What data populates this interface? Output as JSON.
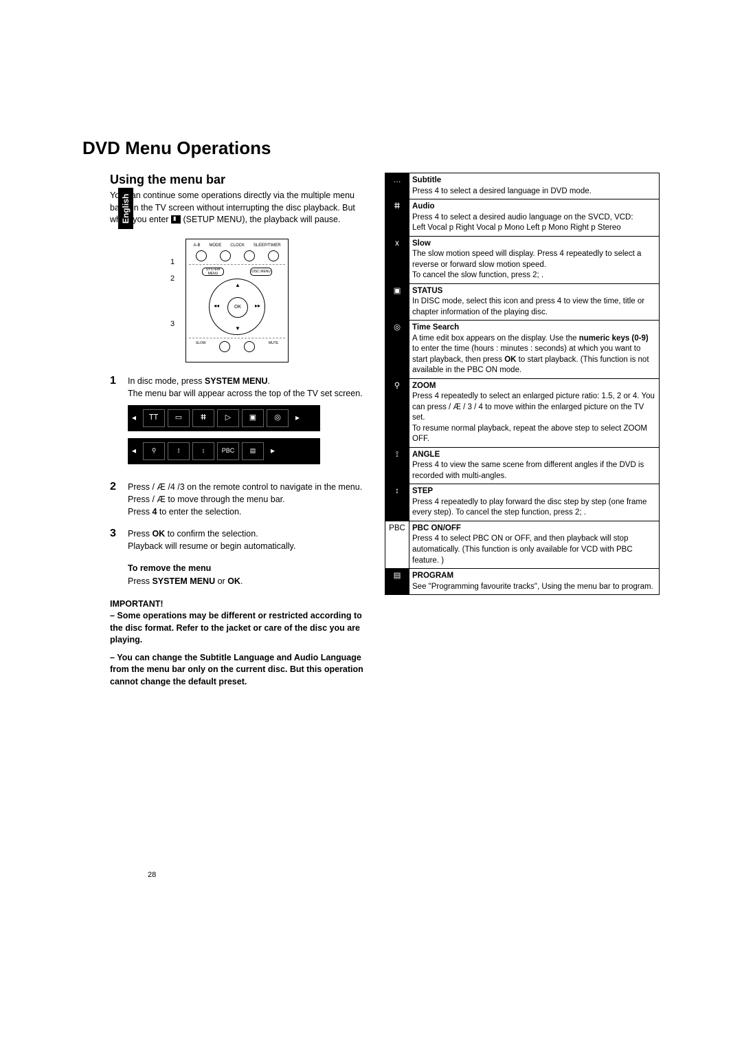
{
  "lang_tab": "English",
  "title": "DVD Menu Operations",
  "subheading": "Using the menu bar",
  "intro_1": "You can continue some operations directly via the multiple menu bars on the TV screen without interrupting the disc playback. But when you enter ",
  "intro_2": " (SETUP MENU), the playback will pause.",
  "diagram": {
    "toprow": [
      "A-B",
      "MODE",
      "CLOCK",
      "SLEEP/TIMER"
    ],
    "system_menu": "SYSTEM MENU",
    "disc_menu": "DISC MENU",
    "ok": "OK",
    "slow": "SLOW",
    "mute": "MUTE",
    "callouts": [
      "1",
      "2",
      "3"
    ]
  },
  "step1": {
    "num": "1",
    "l1a": "In disc mode, press ",
    "l1b": "SYSTEM MENU",
    "l1c": ".",
    "l2": "The menu bar will appear across the top of the TV set screen."
  },
  "bar1_cells": [
    "ᎢᎢ",
    "▭",
    "ⵌ",
    "▷",
    "▣",
    "◎"
  ],
  "bar2_cells": [
    "⚲",
    "⟟",
    "↕",
    "PBC",
    "▤"
  ],
  "step2": {
    "num": "2",
    "l1a": "Press ",
    "l1b": " / Æ /4 /3",
    "l1c": " on the remote control to navigate in the menu.",
    "l2a": "Press ",
    "l2b": " / Æ",
    "l2c": " to move through the menu bar.",
    "l3a": "Press ",
    "l3b": "4",
    "l3c": " to enter the selection."
  },
  "step3": {
    "num": "3",
    "l1a": "Press ",
    "l1b": "OK",
    "l1c": " to confirm the selection.",
    "l2": "Playback will resume or begin automatically."
  },
  "remove": {
    "h": "To remove the menu",
    "a": "Press ",
    "b": "SYSTEM MENU",
    "c": " or ",
    "d": "OK",
    "e": "."
  },
  "important_h": "IMPORTANT!",
  "important_1": "– Some operations may be different or restricted according to the disc format. Refer to the jacket or care of the disc you are playing.",
  "important_2": "– You can change the Subtitle Language and Audio Language from the menu bar only on the current disc. But this operation cannot change the default preset.",
  "table": [
    {
      "icon": "…",
      "dark": true,
      "title": "Subtitle",
      "body": "Press 4  to select a desired language in DVD mode."
    },
    {
      "icon": "ⵌ",
      "dark": true,
      "title": "Audio",
      "body": "Press 4  to select a desired audio language on the SVCD, VCD:\nLeft Vocal p   Right Vocal p   Mono Left p   Mono Right p   Stereo"
    },
    {
      "icon": "x",
      "dark": true,
      "title": "Slow",
      "body": "The slow motion speed will display. Press 4 repeatedly to select a reverse or forward slow motion speed.\nTo cancel the slow function, press 2;  ."
    },
    {
      "icon": "▣",
      "dark": true,
      "title": "STATUS",
      "body": "In DISC mode, select this icon and press 4  to view the time, title or chapter information of the playing disc."
    },
    {
      "icon": "◎",
      "dark": true,
      "title": "Time Search",
      "body": "A time edit box appears on the display. Use the <b>numeric keys (0-9)</b> to enter the time (hours : minutes : seconds) at which you want to start playback, then press <b>OK</b> to start playback. (This function is not available in the PBC ON mode."
    },
    {
      "icon": "⚲",
      "dark": true,
      "title": "ZOOM",
      "body": "Press 4  repeatedly to select an enlarged picture ratio: 1.5, 2 or 4. You can press       / Æ / 3  / 4  to move within the enlarged picture on the TV set.\nTo resume normal playback, repeat the above step to select ZOOM OFF."
    },
    {
      "icon": "⟟",
      "dark": true,
      "title": "ANGLE",
      "body": "Press 4  to view the same scene from different angles  if the DVD is recorded with multi-angles."
    },
    {
      "icon": "↕",
      "dark": true,
      "title": "STEP",
      "body": "Press 4  repeatedly to play forward the disc step by step (one frame every step). To cancel the step function, press 2;  ."
    },
    {
      "icon": "PBC",
      "dark": false,
      "title": "PBC ON/OFF",
      "body": "Press 4  to select PBC ON or OFF, and then playback will stop automatically. (This function is only available for VCD with PBC feature. )"
    },
    {
      "icon": "▤",
      "dark": true,
      "title": "PROGRAM",
      "body": "See \"Programming favourite tracks\", Using the menu bar to program."
    }
  ],
  "page_number": "28"
}
